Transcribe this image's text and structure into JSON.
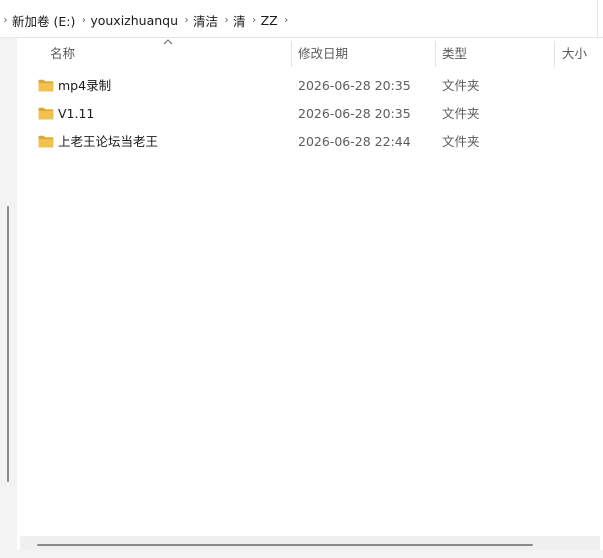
{
  "breadcrumb": {
    "items": [
      {
        "label": "新加卷 (E:)"
      },
      {
        "label": "youxizhuanqu"
      },
      {
        "label": "清洁"
      },
      {
        "label": "清"
      },
      {
        "label": "ZZ"
      }
    ],
    "separator_icon": "chevron-right-icon"
  },
  "columns": {
    "name": "名称",
    "modified": "修改日期",
    "type": "类型",
    "size": "大小"
  },
  "sort": {
    "column": "name",
    "icon": "sort-up-chevron-icon"
  },
  "files": [
    {
      "name": "mp4录制",
      "modified": "2026-06-28 20:35",
      "type": "文件夹",
      "icon": "folder-icon"
    },
    {
      "name": "V1.11",
      "modified": "2026-06-28 20:35",
      "type": "文件夹",
      "icon": "folder-icon"
    },
    {
      "name": "上老王论坛当老王",
      "modified": "2026-06-28 22:44",
      "type": "文件夹",
      "icon": "folder-icon"
    }
  ],
  "colors": {
    "folder": "#f2c14e",
    "folder_dark": "#dca535",
    "scrollbar_thumb": "#8a8a8a",
    "nav_background": "#f3f3f3"
  }
}
